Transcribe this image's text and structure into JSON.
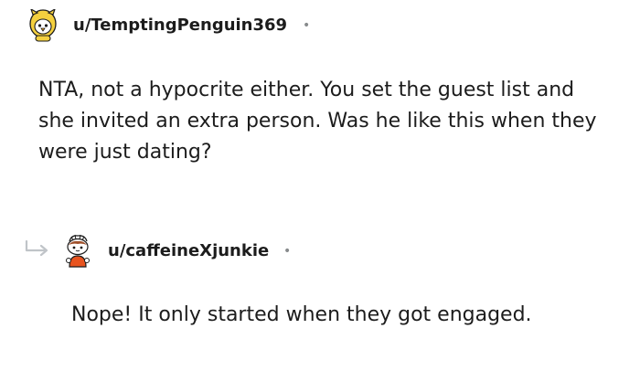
{
  "comments": [
    {
      "username": "u/TemptingPenguin369",
      "separator": "•",
      "avatar_icon": "penguin-costume-avatar-icon",
      "body": "NTA, not a hypocrite either. You set the guest list and she invited an extra person. Was he like this when they were just dating?"
    },
    {
      "username": "u/caffeineXjunkie",
      "separator": "•",
      "avatar_icon": "snoo-avatar-icon",
      "reply_icon": "reply-arrow-icon",
      "body": "Nope! It only started when they got engaged."
    }
  ],
  "colors": {
    "text": "#1c1c1c",
    "muted": "#878a8c",
    "reply_arrow": "#c0c4c8"
  }
}
